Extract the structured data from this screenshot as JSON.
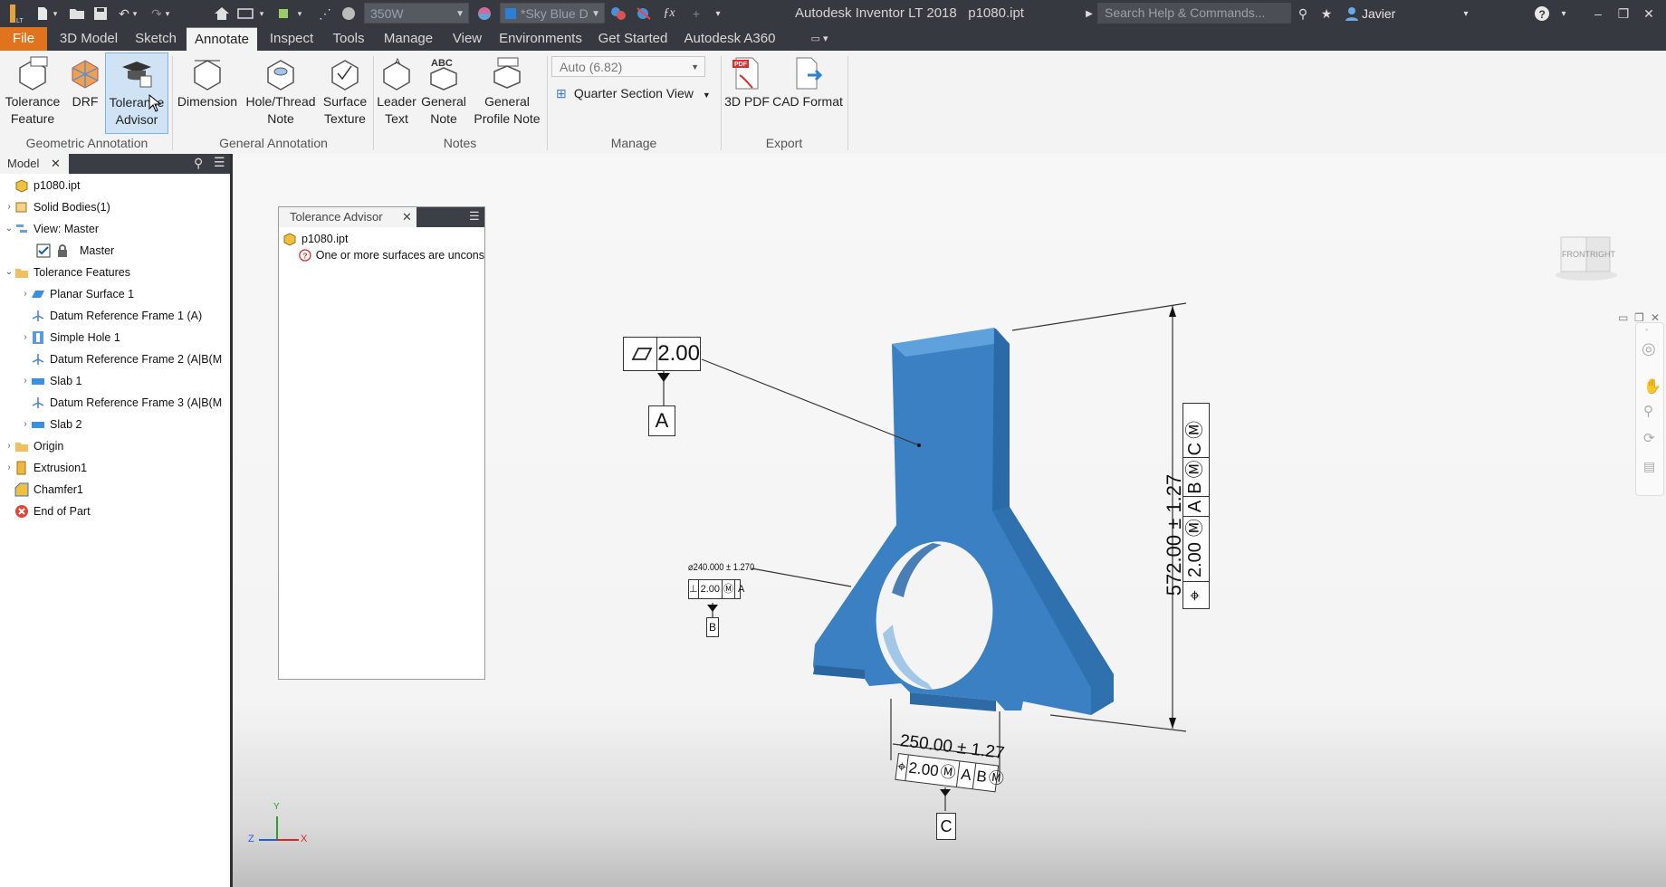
{
  "titlebar": {
    "app_title": "Autodesk Inventor LT 2018",
    "document": "p1080.ipt",
    "material_combo": "350W",
    "appearance_combo": "*Sky Blue D",
    "search_placeholder": "Search Help & Commands...",
    "user": "Javier"
  },
  "tabs": [
    {
      "label": "File"
    },
    {
      "label": "3D Model"
    },
    {
      "label": "Sketch"
    },
    {
      "label": "Annotate"
    },
    {
      "label": "Inspect"
    },
    {
      "label": "Tools"
    },
    {
      "label": "Manage"
    },
    {
      "label": "View"
    },
    {
      "label": "Environments"
    },
    {
      "label": "Get Started"
    },
    {
      "label": "Autodesk A360"
    }
  ],
  "ribbon": {
    "tolerance_feature": [
      "Tolerance",
      "Feature"
    ],
    "drf": "DRF",
    "tolerance_advisor": [
      "Tolerance",
      "Advisor"
    ],
    "dimension": "Dimension",
    "hole_thread_note": [
      "Hole/Thread",
      "Note"
    ],
    "surface_texture": [
      "Surface",
      "Texture"
    ],
    "leader_text": [
      "Leader",
      "Text"
    ],
    "general_note": [
      "General",
      "Note"
    ],
    "general_profile_note": [
      "General",
      "Profile Note"
    ],
    "auto_combo": "Auto (6.82)",
    "quarter_section_view": "Quarter Section View",
    "pdf_3d": "3D PDF",
    "cad_format": "CAD Format",
    "groups": {
      "geometric": "Geometric Annotation",
      "general": "General Annotation",
      "notes": "Notes",
      "manage": "Manage",
      "export": "Export"
    }
  },
  "browser": {
    "tab": "Model",
    "nodes": [
      {
        "label": "p1080.ipt"
      },
      {
        "label": "Solid Bodies(1)"
      },
      {
        "label": "View: Master"
      },
      {
        "label": "Master"
      },
      {
        "label": "Tolerance Features"
      },
      {
        "label": "Planar Surface 1"
      },
      {
        "label": "Datum Reference Frame 1 (A)"
      },
      {
        "label": "Simple Hole 1"
      },
      {
        "label": "Datum Reference Frame 2 (A|B(M"
      },
      {
        "label": "Slab 1"
      },
      {
        "label": "Datum Reference Frame 3 (A|B(M"
      },
      {
        "label": "Slab 2"
      },
      {
        "label": "Origin"
      },
      {
        "label": "Extrusion1"
      },
      {
        "label": "Chamfer1"
      },
      {
        "label": "End of Part"
      }
    ]
  },
  "tolerance_advisor": {
    "title": "Tolerance Advisor",
    "file": "p1080.ipt",
    "message": "One or more surfaces are uncons"
  },
  "annotations": {
    "flatness_value": "2.00",
    "datum_a": "A",
    "datum_b": "B",
    "datum_c": "C",
    "hole_dim": "⌀240.000 ± 1.270",
    "hole_fcf": "2.00",
    "hole_fcf_ref": "A",
    "height_dim": "572.00 ± 1.27",
    "height_fcf": "2.00",
    "height_fcf_refs": [
      "A",
      "B",
      "C"
    ],
    "width_dim": "250.00 ± 1.27",
    "width_fcf": "2.00",
    "width_fcf_refs": [
      "A",
      "B"
    ],
    "navcube_front": "FRONT",
    "navcube_right": "RIGHT",
    "axis_x": "X",
    "axis_y": "Y",
    "axis_z": "Z"
  },
  "colors": {
    "accent_file": "#e0741e",
    "part_blue": "#3a7fc0",
    "titlebar": "#363a40"
  }
}
